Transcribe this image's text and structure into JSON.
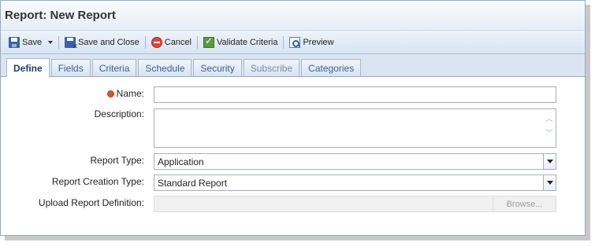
{
  "window": {
    "title": "Report: New Report"
  },
  "toolbar": {
    "save_label": "Save",
    "save_close_label": "Save and Close",
    "cancel_label": "Cancel",
    "validate_label": "Validate Criteria",
    "preview_label": "Preview"
  },
  "tabs": [
    {
      "label": "Define",
      "state": "active"
    },
    {
      "label": "Fields",
      "state": "normal"
    },
    {
      "label": "Criteria",
      "state": "normal"
    },
    {
      "label": "Schedule",
      "state": "normal"
    },
    {
      "label": "Security",
      "state": "normal"
    },
    {
      "label": "Subscribe",
      "state": "disabled"
    },
    {
      "label": "Categories",
      "state": "normal"
    }
  ],
  "form": {
    "name_label": "Name:",
    "name_value": "",
    "description_label": "Description:",
    "description_value": "",
    "report_type_label": "Report Type:",
    "report_type_value": "Application",
    "creation_type_label": "Report Creation Type:",
    "creation_type_value": "Standard Report",
    "upload_label": "Upload Report Definition:",
    "browse_label": "Browse..."
  },
  "colors": {
    "required_indicator": "#e2522b",
    "accent": "#3d5f96"
  }
}
